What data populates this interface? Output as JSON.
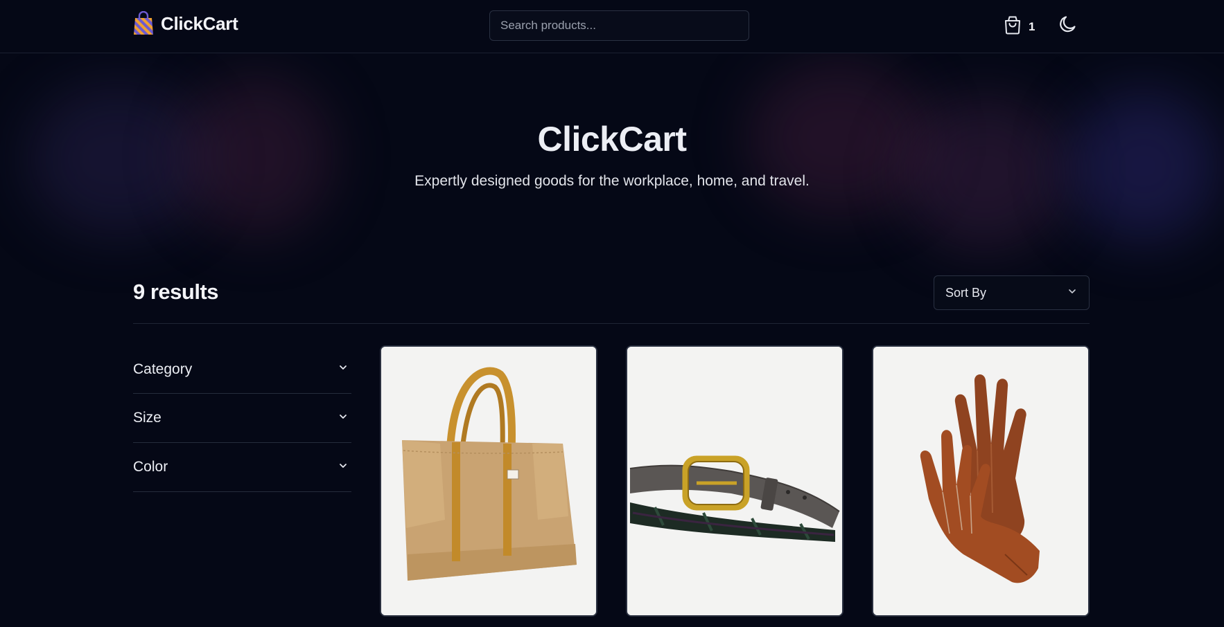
{
  "header": {
    "brand_name": "ClickCart",
    "search_placeholder": "Search products...",
    "cart_count": "1"
  },
  "hero": {
    "title": "ClickCart",
    "subtitle": "Expertly designed goods for the workplace, home, and travel."
  },
  "results": {
    "count_label": "9 results",
    "sort_label": "Sort By"
  },
  "filters": [
    {
      "label": "Category"
    },
    {
      "label": "Size"
    },
    {
      "label": "Color"
    }
  ],
  "products": [
    {
      "image": "canvas-tote-bag"
    },
    {
      "image": "leather-plaid-belt"
    },
    {
      "image": "brown-leather-gloves"
    }
  ],
  "icons": {
    "logo": "shopping-bag-icon",
    "cart": "cart-icon",
    "theme": "moon-icon",
    "chevron": "chevron-down-icon"
  },
  "colors": {
    "background": "#050816",
    "border": "#2a3142",
    "text": "#e6e8ef",
    "logo_purple": "#6d5bd0",
    "logo_orange": "#f0a030"
  }
}
